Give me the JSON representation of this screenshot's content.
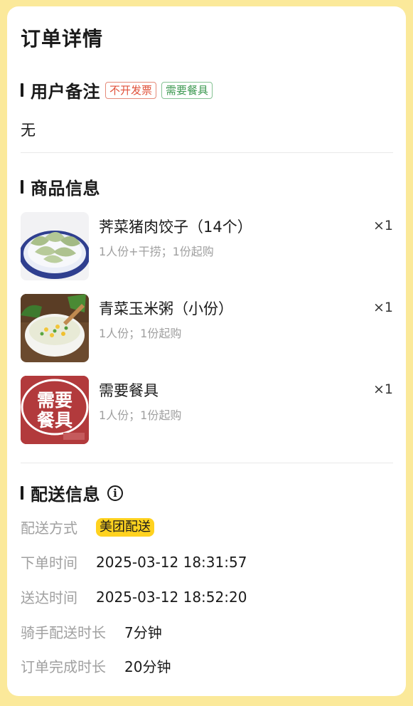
{
  "page": {
    "title": "订单详情"
  },
  "user_note": {
    "heading": "用户备注",
    "tags": [
      "不开发票",
      "需要餐具"
    ],
    "text": "无"
  },
  "goods": {
    "heading": "商品信息",
    "items": [
      {
        "name": "荠菜猪肉饺子（14个）",
        "spec": "1人份+干捞；1份起购",
        "qty": "×1",
        "image": "dumplings-photo"
      },
      {
        "name": "青菜玉米粥（小份）",
        "spec": "1人份；1份起购",
        "qty": "×1",
        "image": "corn-porridge-photo"
      },
      {
        "name": "需要餐具",
        "spec": "1人份；1份起购",
        "qty": "×1",
        "image": "tableware-sign",
        "image_text": [
          "需要",
          "餐具"
        ]
      }
    ]
  },
  "delivery": {
    "heading": "配送信息",
    "info_icon": "info-icon",
    "rows": [
      {
        "label": "配送方式",
        "value": "美团配送"
      },
      {
        "label": "下单时间",
        "value": "2025-03-12 18:31:57"
      },
      {
        "label": "送达时间",
        "value": "2025-03-12 18:52:20"
      },
      {
        "label": "骑手配送时长",
        "value": "7分钟"
      },
      {
        "label": "订单完成时长",
        "value": "20分钟"
      }
    ]
  },
  "colors": {
    "background": "#fbe99a",
    "card": "#ffffff",
    "tag_red": "#e0513a",
    "tag_green": "#3f9a53",
    "delivery_badge": "#ffd21f",
    "muted_text": "#a0a0a0"
  }
}
